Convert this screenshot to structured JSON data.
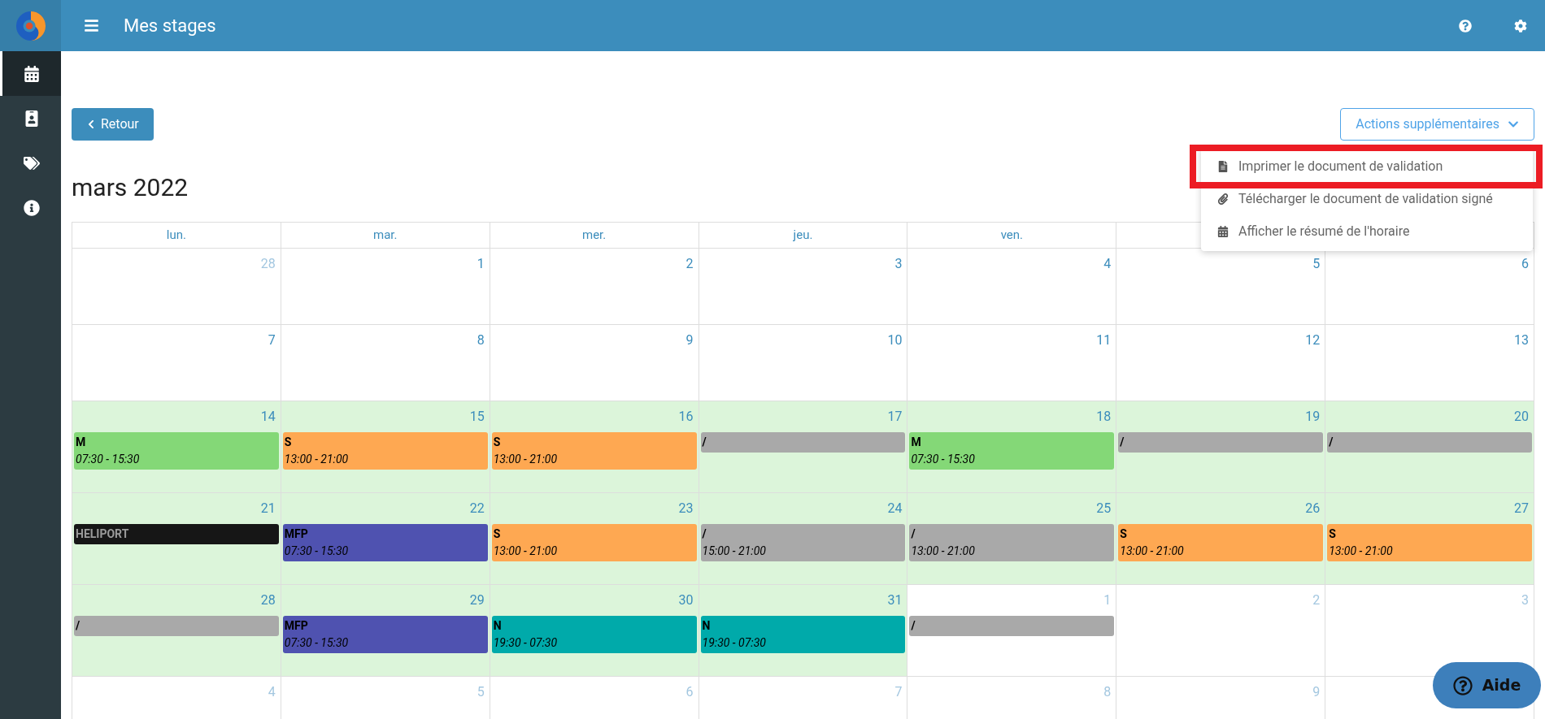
{
  "topbar": {
    "title": "Mes stages"
  },
  "sidebar": {
    "items": [
      {
        "kind": "calendar",
        "selected": true
      },
      {
        "kind": "badge",
        "selected": false
      },
      {
        "kind": "tags",
        "selected": false
      },
      {
        "kind": "info",
        "selected": false
      }
    ]
  },
  "back_button": {
    "label": "Retour"
  },
  "actions": {
    "label": "Actions supplémentaires",
    "expanded": true,
    "items": [
      {
        "kind": "file",
        "label": "Imprimer le document de validation",
        "highlighted": true
      },
      {
        "kind": "paperclip",
        "label": "Télécharger le document de validation signé",
        "highlighted": false
      },
      {
        "kind": "calendar",
        "label": "Afficher le résumé de l'horaire",
        "highlighted": false
      }
    ]
  },
  "month_title": "mars 2022",
  "calendar": {
    "columns": [
      "lun.",
      "mar.",
      "mer.",
      "jeu.",
      "ven."
    ],
    "weeks": [
      {
        "days": [
          {
            "label": "28",
            "muted": true,
            "highlighted": false
          },
          {
            "label": "1",
            "muted": false,
            "highlighted": false
          },
          {
            "label": "2",
            "muted": false,
            "highlighted": false
          },
          {
            "label": "3",
            "muted": false,
            "highlighted": false
          },
          {
            "label": "4",
            "muted": false,
            "highlighted": false
          },
          {
            "label": "5",
            "muted": false,
            "highlighted": false
          },
          {
            "label": "6",
            "muted": false,
            "highlighted": false
          }
        ]
      },
      {
        "days": [
          {
            "label": "7",
            "muted": false,
            "highlighted": false
          },
          {
            "label": "8",
            "muted": false,
            "highlighted": false
          },
          {
            "label": "9",
            "muted": false,
            "highlighted": false
          },
          {
            "label": "10",
            "muted": false,
            "highlighted": false
          },
          {
            "label": "11",
            "muted": false,
            "highlighted": false
          },
          {
            "label": "12",
            "muted": false,
            "highlighted": false
          },
          {
            "label": "13",
            "muted": false,
            "highlighted": false
          }
        ]
      },
      {
        "days": [
          {
            "label": "14",
            "muted": false,
            "highlighted": true,
            "events": [
              {
                "title": "M",
                "time": "07:30 - 15:30",
                "color": "#84d877"
              }
            ]
          },
          {
            "label": "15",
            "muted": false,
            "highlighted": true,
            "events": [
              {
                "title": "S",
                "time": "13:00 - 21:00",
                "color": "#fea852"
              }
            ]
          },
          {
            "label": "16",
            "muted": false,
            "highlighted": true,
            "events": [
              {
                "title": "S",
                "time": "13:00 - 21:00",
                "color": "#fea852"
              }
            ]
          },
          {
            "label": "17",
            "muted": false,
            "highlighted": true,
            "events": [
              {
                "title": "/",
                "color": "#a9a9a9"
              }
            ]
          },
          {
            "label": "18",
            "muted": false,
            "highlighted": true,
            "events": [
              {
                "title": "M",
                "time": "07:30 - 15:30",
                "color": "#84d877"
              }
            ]
          },
          {
            "label": "19",
            "muted": false,
            "highlighted": true,
            "events": [
              {
                "title": "/",
                "color": "#a9a9a9"
              }
            ]
          },
          {
            "label": "20",
            "muted": false,
            "highlighted": true,
            "events": [
              {
                "title": "/",
                "color": "#a9a9a9"
              }
            ]
          }
        ]
      },
      {
        "days": [
          {
            "label": "21",
            "muted": false,
            "highlighted": true,
            "events": [
              {
                "title": "HELIPORT",
                "color": "#161616"
              }
            ]
          },
          {
            "label": "22",
            "muted": false,
            "highlighted": true,
            "events": [
              {
                "title": "MFP",
                "time": "07:30 - 15:30",
                "color": "#4f52b0"
              }
            ]
          },
          {
            "label": "23",
            "muted": false,
            "highlighted": true,
            "events": [
              {
                "title": "S",
                "time": "13:00 - 21:00",
                "color": "#fea852"
              }
            ]
          },
          {
            "label": "24",
            "muted": false,
            "highlighted": true,
            "events": [
              {
                "title": "/",
                "time": "15:00 - 21:00",
                "color": "#a9a9a9"
              }
            ]
          },
          {
            "label": "25",
            "muted": false,
            "highlighted": true,
            "events": [
              {
                "title": "/",
                "time": "13:00 - 21:00",
                "color": "#a9a9a9"
              }
            ]
          },
          {
            "label": "26",
            "muted": false,
            "highlighted": true,
            "events": [
              {
                "title": "S",
                "time": "13:00 - 21:00",
                "color": "#fea852"
              }
            ]
          },
          {
            "label": "27",
            "muted": false,
            "highlighted": true,
            "events": [
              {
                "title": "S",
                "time": "13:00 - 21:00",
                "color": "#fea852"
              }
            ]
          }
        ]
      },
      {
        "days": [
          {
            "label": "28",
            "muted": false,
            "highlighted": true,
            "events": [
              {
                "title": "/",
                "color": "#a9a9a9"
              }
            ]
          },
          {
            "label": "29",
            "muted": false,
            "highlighted": true,
            "events": [
              {
                "title": "MFP",
                "time": "07:30 - 15:30",
                "color": "#4f52b0"
              }
            ]
          },
          {
            "label": "30",
            "muted": false,
            "highlighted": true,
            "events": [
              {
                "title": "N",
                "time": "19:30 - 07:30",
                "color": "#00aaaa"
              }
            ]
          },
          {
            "label": "31",
            "muted": false,
            "highlighted": true,
            "events": [
              {
                "title": "N",
                "time": "19:30 - 07:30",
                "color": "#00aaaa"
              }
            ]
          },
          {
            "label": "1",
            "muted": true,
            "highlighted": false,
            "events": [
              {
                "title": "/",
                "color": "#a9a9a9"
              }
            ]
          },
          {
            "label": "2",
            "muted": true,
            "highlighted": false
          },
          {
            "label": "3",
            "muted": true,
            "highlighted": false
          }
        ]
      },
      {
        "days": [
          {
            "label": "4",
            "muted": true,
            "highlighted": false
          },
          {
            "label": "5",
            "muted": true,
            "highlighted": false
          },
          {
            "label": "6",
            "muted": true,
            "highlighted": false
          },
          {
            "label": "7",
            "muted": true,
            "highlighted": false
          },
          {
            "label": "8",
            "muted": true,
            "highlighted": false
          },
          {
            "label": "9",
            "muted": true,
            "highlighted": false
          },
          {
            "highlighted": false
          }
        ]
      }
    ]
  },
  "help_button": {
    "label": "Aide"
  }
}
